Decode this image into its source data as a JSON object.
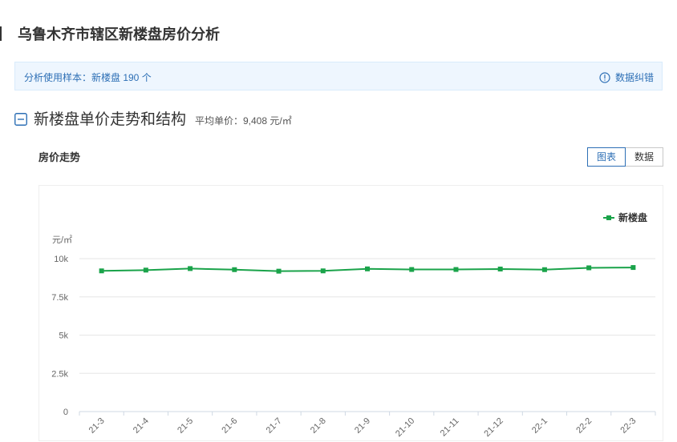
{
  "page": {
    "title": "乌鲁木齐市辖区新楼盘房价分析"
  },
  "sample": {
    "text": "分析使用样本：新楼盘 190 个",
    "correction_label": "数据纠错"
  },
  "section": {
    "title": "新楼盘单价走势和结构",
    "avg_price": "平均单价：9,408 元/㎡"
  },
  "trend": {
    "label": "房价走势",
    "toggle": [
      "图表",
      "数据"
    ],
    "active_toggle": "图表"
  },
  "colors": {
    "accent": "#2d6fb5",
    "series": "#1aa34a",
    "info_bg": "#eef6fe"
  },
  "icons": {
    "info": "info-circle-icon",
    "collapse": "minus-square-icon"
  },
  "chart_data": {
    "type": "line",
    "ylabel": "元/㎡",
    "y_ticks": [
      "0",
      "2.5k",
      "5k",
      "7.5k",
      "10k"
    ],
    "ylim": [
      0,
      10000
    ],
    "grid": true,
    "legend_position": "top-right",
    "categories": [
      "21-3",
      "21-4",
      "21-5",
      "21-6",
      "21-7",
      "21-8",
      "21-9",
      "21-10",
      "21-11",
      "21-12",
      "22-1",
      "22-2",
      "22-3"
    ],
    "series": [
      {
        "name": "新楼盘",
        "values": [
          9200,
          9250,
          9350,
          9280,
          9180,
          9200,
          9330,
          9290,
          9290,
          9320,
          9280,
          9400,
          9420
        ]
      }
    ]
  }
}
